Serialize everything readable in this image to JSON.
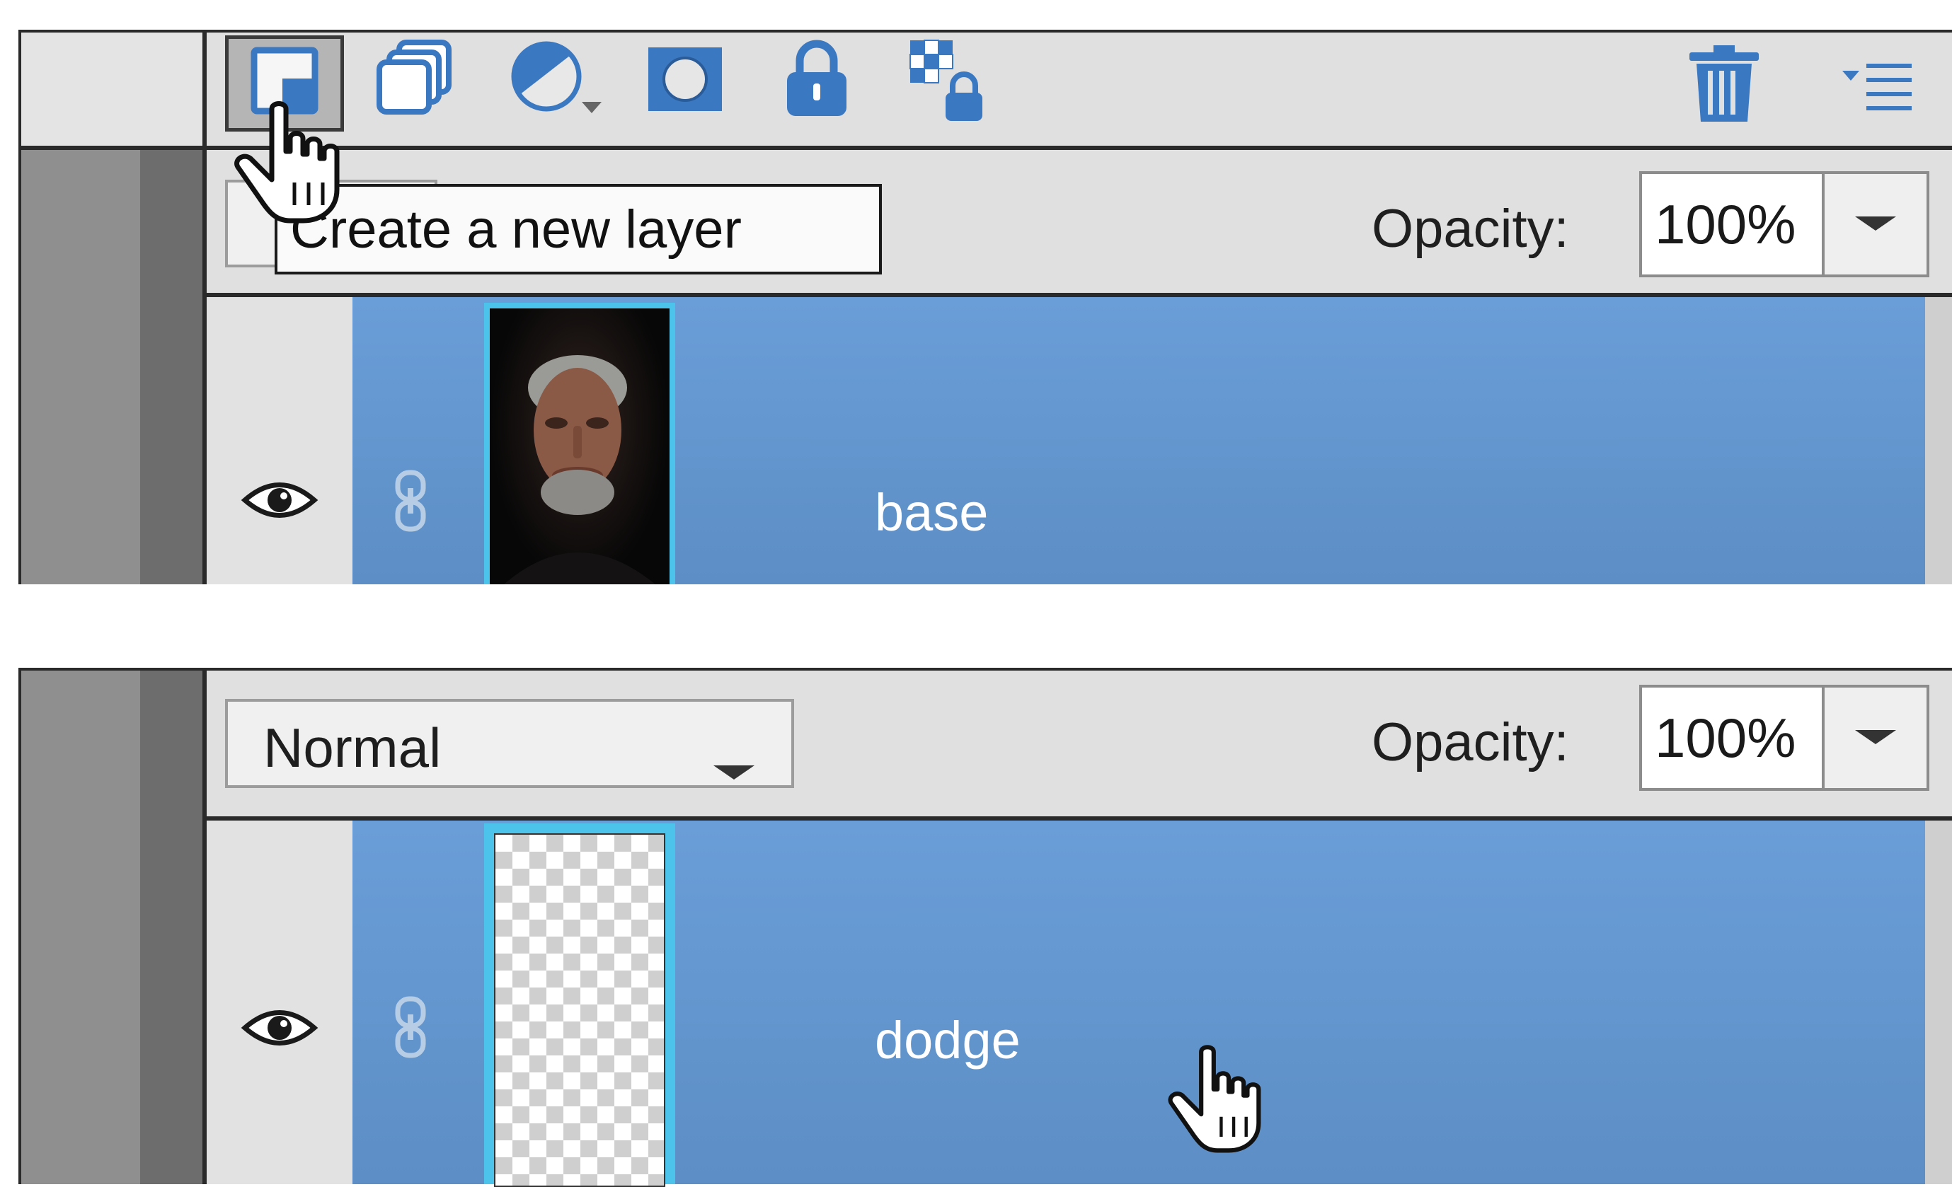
{
  "toolbar": {
    "icons": [
      "new-layer-icon",
      "duplicate-layer-icon",
      "adjustment-layer-icon",
      "layer-mask-icon",
      "lock-all-icon",
      "lock-transparency-icon",
      "trash-icon",
      "panel-menu-icon"
    ]
  },
  "tooltip": {
    "text": "Create a new layer"
  },
  "panel_top": {
    "opacity_label": "Opacity:",
    "opacity_value": "100%",
    "layer": {
      "name": "base",
      "thumbnail": "portrait-photo"
    }
  },
  "panel_bottom": {
    "blend_mode": "Normal",
    "opacity_label": "Opacity:",
    "opacity_value": "100%",
    "layer": {
      "name": "dodge",
      "thumbnail": "transparent"
    }
  },
  "colors": {
    "selected_layer_bg": "#6394cf",
    "panel_bg": "#e0e0e0",
    "thumbnail_border": "#4cc3ea"
  }
}
